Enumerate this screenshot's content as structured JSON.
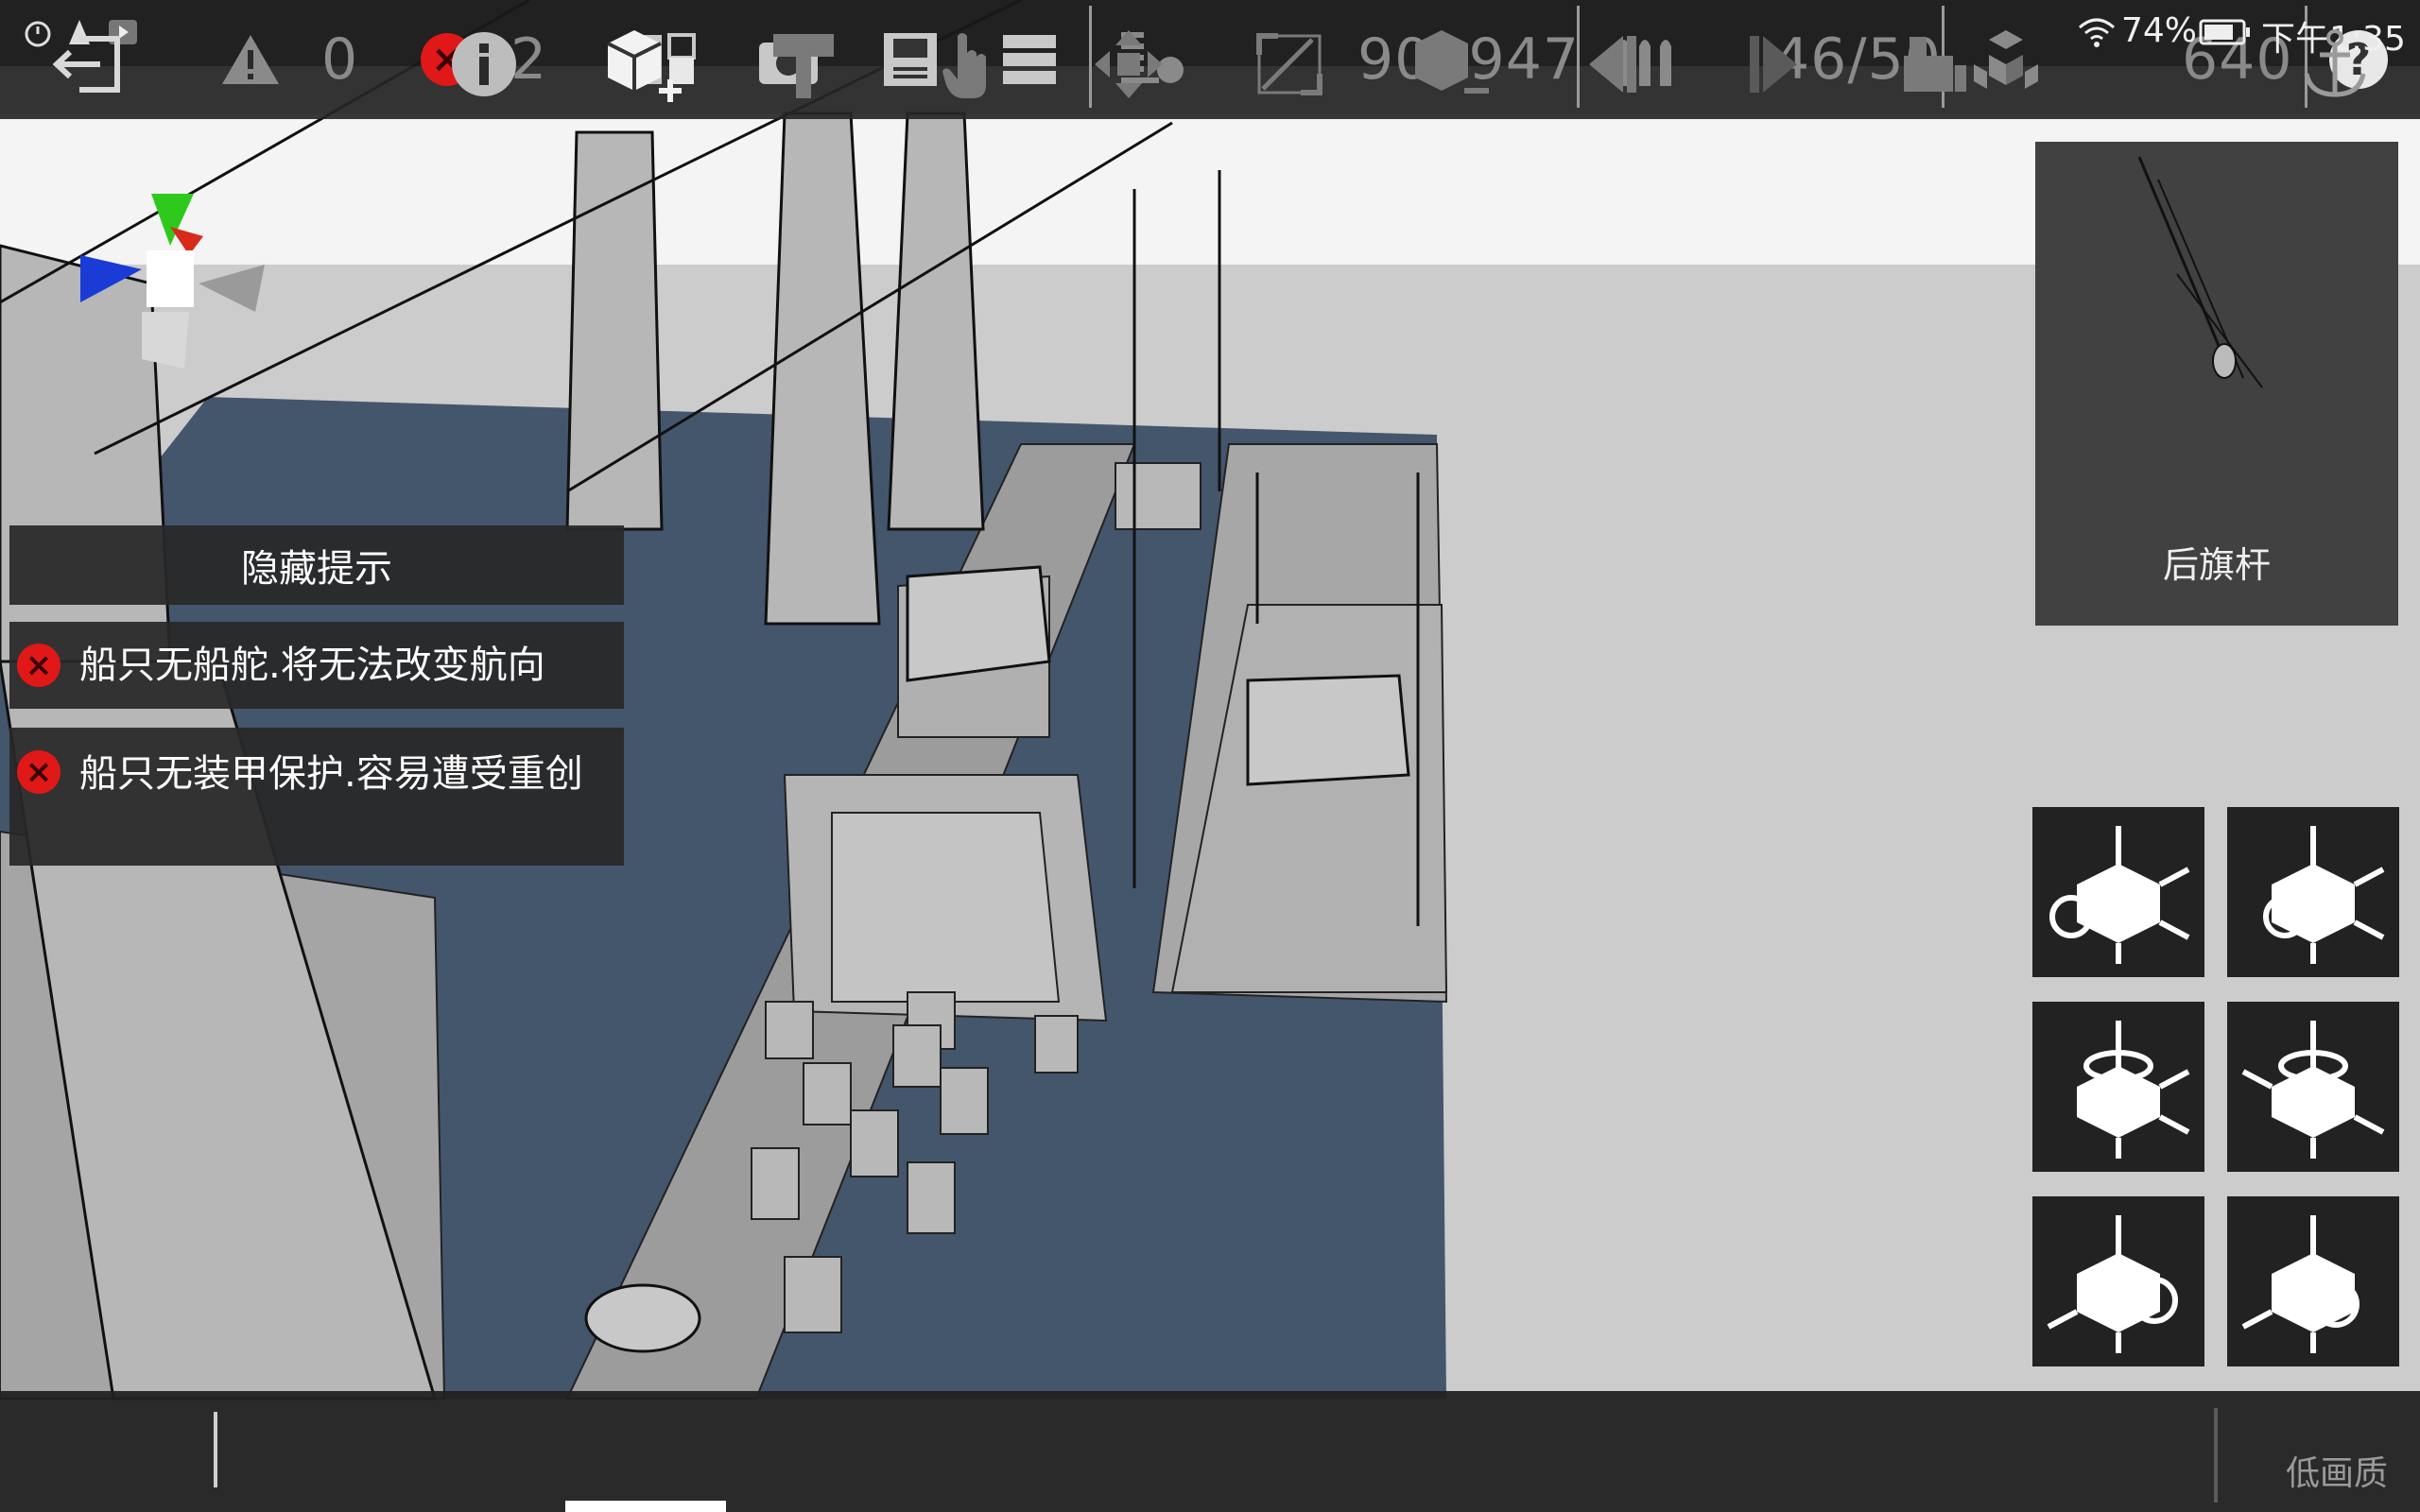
{
  "status": {
    "battery": "74%",
    "time": "下午1:35",
    "status_icons": [
      "alarm-icon",
      "app-icon",
      "play-icon"
    ]
  },
  "topbar": {
    "warning_count": "0",
    "error_count": "2",
    "cost": "909947",
    "parts": "46/50",
    "weight": "640",
    "icons": [
      "warning-icon",
      "error-icon",
      "compare-icon",
      "screenshot-icon",
      "save-icon",
      "menu-icon",
      "weight-icon",
      "ammo-icon",
      "blocks-icon",
      "help-icon"
    ]
  },
  "hints": {
    "toggle_label": "隐藏提示",
    "items": [
      {
        "text": "船只无船舵.将无法改变航向"
      },
      {
        "text": "船只无装甲保护.容易遭受重创"
      }
    ]
  },
  "preview": {
    "label": "后旗杆"
  },
  "rotate_buttons": [
    {
      "name": "rotate-left-x-icon"
    },
    {
      "name": "rotate-right-x-icon"
    },
    {
      "name": "rotate-left-y-icon"
    },
    {
      "name": "rotate-right-y-icon"
    },
    {
      "name": "rotate-left-z-icon"
    },
    {
      "name": "rotate-right-z-icon"
    }
  ],
  "bottombar": {
    "quality_label": "低画质",
    "tools": [
      "exit-icon",
      "info-icon",
      "add-part-icon",
      "paint-icon",
      "select-hand-icon",
      "move-icon",
      "scale-icon",
      "remove-part-icon",
      "undo-icon",
      "redo-icon",
      "mirror-icon",
      "anchor-icon"
    ],
    "selected_tool": "add-part-icon"
  },
  "colors": {
    "deck": "#44566c",
    "hull": "#9a9a9a",
    "panel": "#2b2b2b",
    "error": "#e01818",
    "axis_x": "#1a3bd6",
    "axis_y": "#2fc81c",
    "axis_z": "#d82a1a"
  }
}
